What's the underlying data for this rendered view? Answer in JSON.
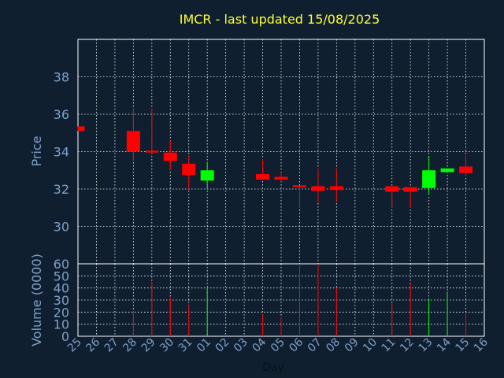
{
  "chart_data": {
    "type": "candlestick",
    "title": "IMCR - last updated 15/08/2025",
    "xlabel": "Day",
    "ylabel_price": "Price",
    "ylabel_volume": "Volume (0000)",
    "x_ticks": [
      "25",
      "26",
      "27",
      "28",
      "29",
      "30",
      "31",
      "01",
      "02",
      "03",
      "04",
      "05",
      "06",
      "07",
      "08",
      "09",
      "10",
      "11",
      "12",
      "13",
      "14",
      "15",
      "16"
    ],
    "price_ylim": [
      28,
      40
    ],
    "price_ticks": [
      30,
      32,
      34,
      36,
      38
    ],
    "volume_ylim": [
      0,
      60
    ],
    "volume_ticks": [
      0,
      10,
      20,
      30,
      40,
      50,
      60
    ],
    "grid": true,
    "candles": [
      {
        "day": "25",
        "open": 35.35,
        "high": 35.35,
        "low": 35.1,
        "close": 35.1,
        "volume": 0
      },
      {
        "day": "28",
        "open": 35.1,
        "high": 36.3,
        "low": 33.5,
        "close": 34.0,
        "volume": 21
      },
      {
        "day": "29",
        "open": 34.05,
        "high": 36.3,
        "low": 33.9,
        "close": 33.95,
        "volume": 45
      },
      {
        "day": "30",
        "open": 33.95,
        "high": 34.6,
        "low": 33.0,
        "close": 33.5,
        "volume": 32
      },
      {
        "day": "31",
        "open": 33.35,
        "high": 33.8,
        "low": 32.0,
        "close": 32.75,
        "volume": 26
      },
      {
        "day": "01",
        "open": 32.45,
        "high": 33.45,
        "low": 32.0,
        "close": 33.0,
        "volume": 40
      },
      {
        "day": "04",
        "open": 32.8,
        "high": 33.6,
        "low": 32.5,
        "close": 32.5,
        "volume": 18
      },
      {
        "day": "05",
        "open": 32.65,
        "high": 32.9,
        "low": 32.4,
        "close": 32.5,
        "volume": 16
      },
      {
        "day": "06",
        "open": 32.2,
        "high": 32.2,
        "low": 31.0,
        "close": 32.1,
        "volume": 60
      },
      {
        "day": "07",
        "open": 32.15,
        "high": 33.1,
        "low": 31.25,
        "close": 31.9,
        "volume": 60
      },
      {
        "day": "08",
        "open": 32.15,
        "high": 33.1,
        "low": 31.3,
        "close": 31.95,
        "volume": 40
      },
      {
        "day": "11",
        "open": 32.15,
        "high": 32.2,
        "low": 31.0,
        "close": 31.85,
        "volume": 28
      },
      {
        "day": "12",
        "open": 32.1,
        "high": 32.1,
        "low": 31.0,
        "close": 31.85,
        "volume": 44
      },
      {
        "day": "13",
        "open": 32.05,
        "high": 33.75,
        "low": 31.7,
        "close": 33.0,
        "volume": 31
      },
      {
        "day": "14",
        "open": 32.9,
        "high": 33.1,
        "low": 32.9,
        "close": 33.1,
        "volume": 37
      },
      {
        "day": "15",
        "open": 33.2,
        "high": 33.8,
        "low": 32.7,
        "close": 32.85,
        "volume": 19
      }
    ],
    "colors": {
      "background": "#0f1f30",
      "title": "#ffff33",
      "axis_text": "#7fa0c8",
      "grid": "#ffffff",
      "up": "#00ff00",
      "down": "#ff0000"
    }
  }
}
